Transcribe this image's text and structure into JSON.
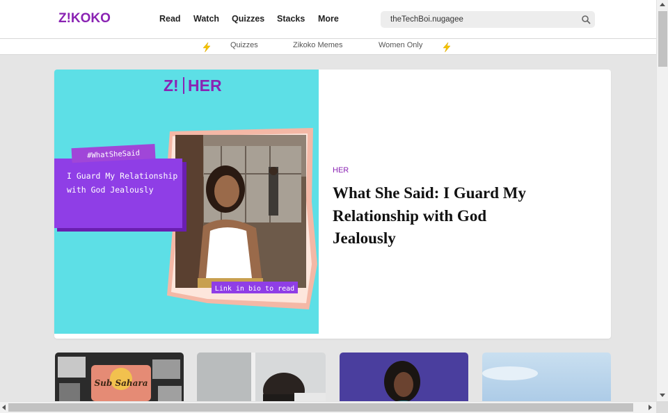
{
  "header": {
    "logo_text": "Z!KOKO",
    "nav": [
      "Read",
      "Watch",
      "Quizzes",
      "Stacks",
      "More"
    ],
    "search": {
      "value": "theTechBoi.nugagee",
      "icon": "search-icon"
    }
  },
  "subnav": {
    "items": [
      "Quizzes",
      "Zikoko Memes",
      "Women Only"
    ],
    "icon": "lightning-bolt-icon"
  },
  "hero": {
    "image": {
      "brand": "Z!",
      "brand_section": "HER",
      "hashtag": "#WhatSheSaid",
      "quote": "I Guard My Relationship with God Jealously",
      "cta": "Link in bio to read"
    },
    "category": "HER",
    "title": "What She Said: I Guard My Relationship with God Jealously"
  },
  "cards": [
    {
      "image_caption": "Sub Sahara"
    },
    {
      "image_caption": ""
    },
    {
      "image_caption": ""
    },
    {
      "image_caption": ""
    }
  ],
  "colors": {
    "brand_purple": "#8a23b3",
    "hero_cyan": "#5ddfe6",
    "quote_purple": "#8f3ee6",
    "page_background": "#e5e5e5"
  }
}
